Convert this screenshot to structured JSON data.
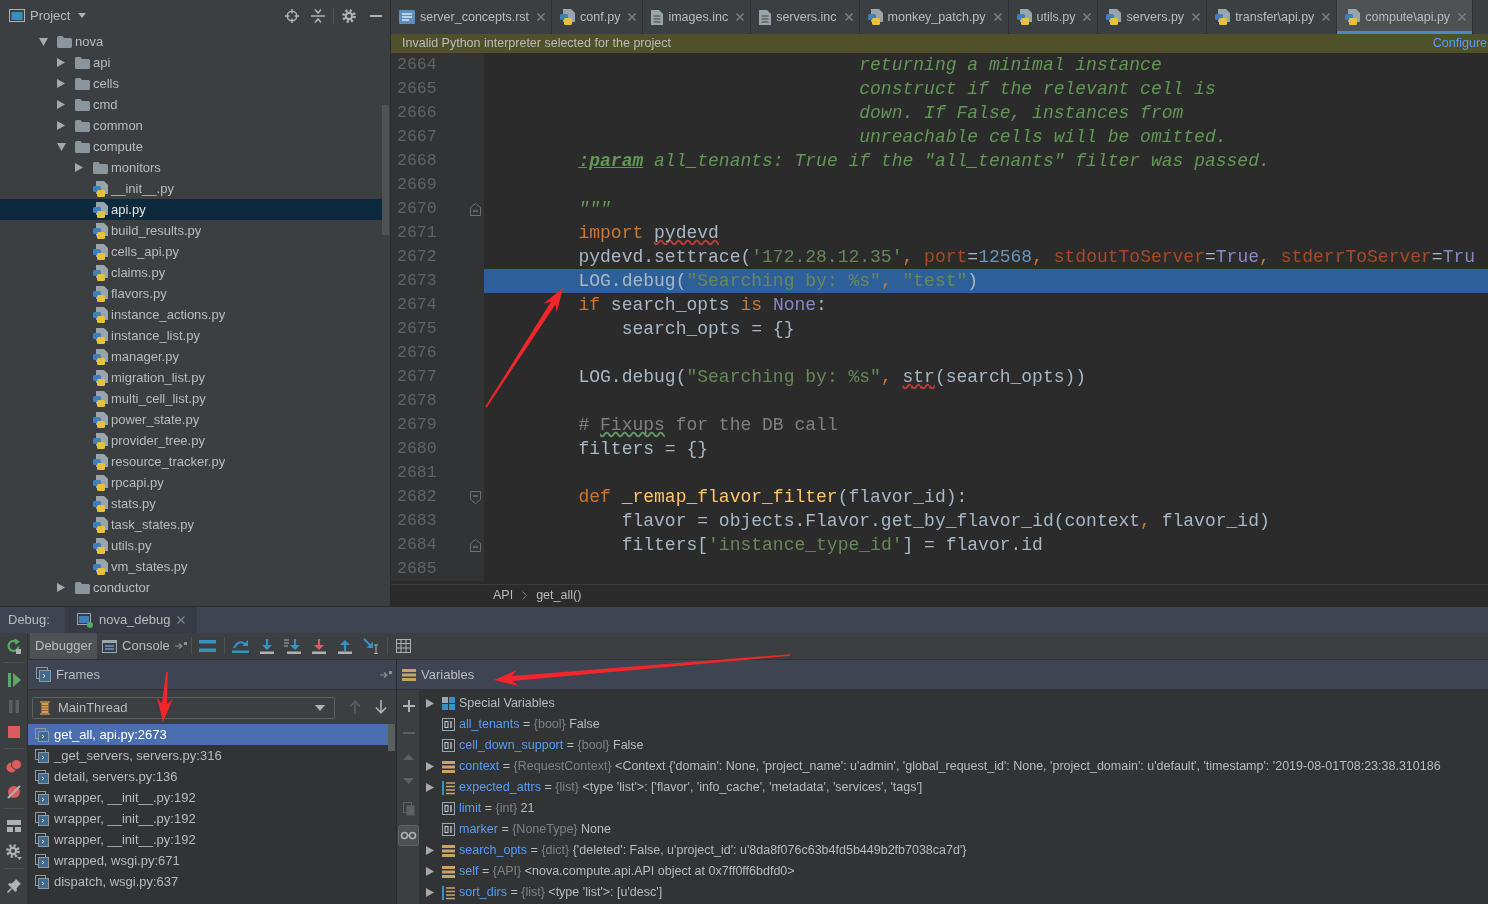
{
  "project_panel": {
    "title": "Project",
    "tree": [
      {
        "label": "nova",
        "kind": "folder",
        "expanded": true,
        "selected": false,
        "children": [
          {
            "label": "api",
            "kind": "folder",
            "expanded": false,
            "selected": false
          },
          {
            "label": "cells",
            "kind": "folder",
            "expanded": false,
            "selected": false
          },
          {
            "label": "cmd",
            "kind": "folder",
            "expanded": false,
            "selected": false
          },
          {
            "label": "common",
            "kind": "folder",
            "expanded": false,
            "selected": false
          },
          {
            "label": "compute",
            "kind": "folder",
            "expanded": true,
            "selected": false,
            "children": [
              {
                "label": "monitors",
                "kind": "folder",
                "expanded": false,
                "selected": false
              },
              {
                "label": "__init__.py",
                "kind": "python",
                "selected": false
              },
              {
                "label": "api.py",
                "kind": "python",
                "selected": true
              },
              {
                "label": "build_results.py",
                "kind": "python",
                "selected": false
              },
              {
                "label": "cells_api.py",
                "kind": "python",
                "selected": false
              },
              {
                "label": "claims.py",
                "kind": "python",
                "selected": false
              },
              {
                "label": "flavors.py",
                "kind": "python",
                "selected": false
              },
              {
                "label": "instance_actions.py",
                "kind": "python",
                "selected": false
              },
              {
                "label": "instance_list.py",
                "kind": "python",
                "selected": false
              },
              {
                "label": "manager.py",
                "kind": "python",
                "selected": false
              },
              {
                "label": "migration_list.py",
                "kind": "python",
                "selected": false
              },
              {
                "label": "multi_cell_list.py",
                "kind": "python",
                "selected": false
              },
              {
                "label": "power_state.py",
                "kind": "python",
                "selected": false
              },
              {
                "label": "provider_tree.py",
                "kind": "python",
                "selected": false
              },
              {
                "label": "resource_tracker.py",
                "kind": "python",
                "selected": false
              },
              {
                "label": "rpcapi.py",
                "kind": "python",
                "selected": false
              },
              {
                "label": "stats.py",
                "kind": "python",
                "selected": false
              },
              {
                "label": "task_states.py",
                "kind": "python",
                "selected": false
              },
              {
                "label": "utils.py",
                "kind": "python",
                "selected": false
              },
              {
                "label": "vm_states.py",
                "kind": "python",
                "selected": false
              }
            ]
          },
          {
            "label": "conductor",
            "kind": "folder",
            "expanded": false,
            "selected": false
          }
        ]
      }
    ]
  },
  "editor": {
    "tabs": [
      {
        "label": "server_concepts.rst",
        "kind": "rst",
        "selected": false
      },
      {
        "label": "conf.py",
        "kind": "python",
        "selected": false
      },
      {
        "label": "images.inc",
        "kind": "text",
        "selected": false
      },
      {
        "label": "servers.inc",
        "kind": "text",
        "selected": false
      },
      {
        "label": "monkey_patch.py",
        "kind": "python",
        "selected": false
      },
      {
        "label": "utils.py",
        "kind": "python",
        "selected": false
      },
      {
        "label": "servers.py",
        "kind": "python",
        "selected": false
      },
      {
        "label": "transfer\\api.py",
        "kind": "python",
        "selected": false
      },
      {
        "label": "compute\\api.py",
        "kind": "python",
        "selected": true
      }
    ],
    "banner": {
      "message": "Invalid Python interpreter selected for the project",
      "action": "Configure"
    },
    "code_lines": [
      {
        "number": "2664",
        "current": false,
        "tokens": [
          {
            "kind": "doc",
            "text": "                                  returning a minimal instance"
          }
        ]
      },
      {
        "number": "2665",
        "current": false,
        "tokens": [
          {
            "kind": "doc",
            "text": "                                  construct if the relevant cell is"
          }
        ]
      },
      {
        "number": "2666",
        "current": false,
        "tokens": [
          {
            "kind": "doc",
            "text": "                                  down. If False, instances from"
          }
        ]
      },
      {
        "number": "2667",
        "current": false,
        "tokens": [
          {
            "kind": "doc",
            "text": "                                  unreachable cells will be omitted."
          }
        ]
      },
      {
        "number": "2668",
        "current": false,
        "tokens": [
          {
            "kind": "doc_tag",
            "text": "        :param"
          },
          {
            "kind": "doc",
            "text": " all_tenants: True if the \"all_tenants\" filter was passed."
          }
        ]
      },
      {
        "number": "2669",
        "current": false
      },
      {
        "number": "2670",
        "current": false,
        "fold": {
          "kind": "end"
        },
        "tokens": [
          {
            "kind": "doc",
            "text": "        \"\"\""
          }
        ]
      },
      {
        "number": "2671",
        "current": false,
        "tokens": [
          {
            "kind": "keyword",
            "text": "        import"
          },
          {
            "kind": "unresolved",
            "text": " pydevd"
          }
        ]
      },
      {
        "number": "2672",
        "current": false,
        "tokens": [
          {
            "kind": "plain",
            "text": "        pydevd.settrace("
          },
          {
            "kind": "string",
            "text": "'172.28.12.35'"
          },
          {
            "kind": "delimiter",
            "text": ", "
          },
          {
            "kind": "param",
            "text": "port"
          },
          {
            "kind": "plain",
            "text": "="
          },
          {
            "kind": "number",
            "text": "12568"
          },
          {
            "kind": "delimiter",
            "text": ", "
          },
          {
            "kind": "param",
            "text": "stdoutToServer"
          },
          {
            "kind": "plain",
            "text": "="
          },
          {
            "kind": "constant",
            "text": "True"
          },
          {
            "kind": "delimiter",
            "text": ", "
          },
          {
            "kind": "param",
            "text": "stderrToServer"
          },
          {
            "kind": "plain",
            "text": "="
          },
          {
            "kind": "constant",
            "text": "Tru"
          }
        ]
      },
      {
        "number": "2673",
        "current": true,
        "tokens": [
          {
            "kind": "plain",
            "text": "        LOG.debug("
          },
          {
            "kind": "string",
            "text": "\"Searching by: %s\""
          },
          {
            "kind": "delimiter",
            "text": ", "
          },
          {
            "kind": "string",
            "text": "\"test\""
          },
          {
            "kind": "plain",
            "text": ")"
          }
        ]
      },
      {
        "number": "2674",
        "current": false,
        "tokens": [
          {
            "kind": "keyword",
            "text": "        if"
          },
          {
            "kind": "plain",
            "text": " search_opts "
          },
          {
            "kind": "keyword",
            "text": "is"
          },
          {
            "kind": "constant",
            "text": " None"
          },
          {
            "kind": "plain",
            "text": ":"
          }
        ]
      },
      {
        "number": "2675",
        "current": false,
        "tokens": [
          {
            "kind": "plain",
            "text": "            search_opts = {}"
          }
        ]
      },
      {
        "number": "2676",
        "current": false
      },
      {
        "number": "2677",
        "current": false,
        "tokens": [
          {
            "kind": "plain",
            "text": "        LOG.debug("
          },
          {
            "kind": "string",
            "text": "\"Searching by: %s\""
          },
          {
            "kind": "delimiter",
            "text": ", "
          },
          {
            "kind": "unresolved",
            "text": "str"
          },
          {
            "kind": "plain",
            "text": "(search_opts))"
          }
        ]
      },
      {
        "number": "2678",
        "current": false
      },
      {
        "number": "2679",
        "current": false,
        "tokens": [
          {
            "kind": "comment",
            "text": "        # "
          },
          {
            "kind": "typo",
            "text": "Fixups"
          },
          {
            "kind": "comment",
            "text": " for the DB call"
          }
        ]
      },
      {
        "number": "2680",
        "current": false,
        "tokens": [
          {
            "kind": "plain",
            "text": "        filters = {}"
          }
        ]
      },
      {
        "number": "2681",
        "current": false
      },
      {
        "number": "2682",
        "current": false,
        "fold": {
          "kind": "start"
        },
        "tokens": [
          {
            "kind": "keyword",
            "text": "        def"
          },
          {
            "kind": "function",
            "text": " _remap_flavor_filter"
          },
          {
            "kind": "plain",
            "text": "(flavor_id):"
          }
        ]
      },
      {
        "number": "2683",
        "current": false,
        "tokens": [
          {
            "kind": "plain",
            "text": "            flavor = objects.Flavor.get_by_flavor_id(context"
          },
          {
            "kind": "delimiter",
            "text": ", "
          },
          {
            "kind": "plain",
            "text": "flavor_id)"
          }
        ]
      },
      {
        "number": "2684",
        "current": false,
        "fold": {
          "kind": "end"
        },
        "tokens": [
          {
            "kind": "plain",
            "text": "            filters["
          },
          {
            "kind": "string",
            "text": "'instance_type_id'"
          },
          {
            "kind": "plain",
            "text": "] = flavor.id"
          }
        ]
      },
      {
        "number": "2685",
        "current": false
      }
    ],
    "breadcrumbs": [
      "API",
      "get_all()"
    ]
  },
  "debug": {
    "title": "Debug:",
    "session": "nova_debug",
    "side_toolbar": [
      {
        "kind": "rerun",
        "disabled": false
      },
      {
        "kind": "resume",
        "disabled": false
      },
      {
        "kind": "pause",
        "disabled": true
      },
      {
        "kind": "stop",
        "disabled": false
      },
      {
        "kind": "breakpoints",
        "disabled": false
      },
      {
        "kind": "mute_breakpoints",
        "disabled": false
      },
      {
        "kind": "layout",
        "disabled": false
      },
      {
        "kind": "settings",
        "disabled": false
      },
      {
        "kind": "pin",
        "disabled": false
      }
    ],
    "tabs": [
      {
        "label": "Debugger",
        "kind": "debugger",
        "selected": true
      },
      {
        "label": "Console",
        "kind": "console",
        "selected": false
      }
    ],
    "frames": {
      "title": "Frames",
      "thread": "MainThread",
      "navigation": [
        {
          "kind": "up",
          "disabled": true
        },
        {
          "kind": "down",
          "disabled": false
        }
      ],
      "items": [
        {
          "label": "get_all, api.py:2673",
          "selected": true
        },
        {
          "label": "_get_servers, servers.py:316",
          "selected": false
        },
        {
          "label": "detail, servers.py:136",
          "selected": false
        },
        {
          "label": "wrapper, __init__.py:192",
          "selected": false
        },
        {
          "label": "wrapper, __init__.py:192",
          "selected": false
        },
        {
          "label": "wrapper, __init__.py:192",
          "selected": false
        },
        {
          "label": "wrapped, wsgi.py:671",
          "selected": false
        },
        {
          "label": "dispatch, wsgi.py:637",
          "selected": false
        }
      ]
    },
    "variables": {
      "title": "Variables",
      "toolbar": [
        {
          "kind": "add",
          "disabled": false,
          "toggled": false
        },
        {
          "kind": "remove",
          "disabled": true,
          "toggled": false
        },
        {
          "kind": "move_up",
          "disabled": true,
          "toggled": false
        },
        {
          "kind": "move_down",
          "disabled": true,
          "toggled": false
        },
        {
          "kind": "copy",
          "disabled": true,
          "toggled": false
        },
        {
          "kind": "watches",
          "disabled": false,
          "toggled": true
        }
      ],
      "items": [
        {
          "name": "Special Variables",
          "kind": "group",
          "expanded": false
        },
        {
          "name": "all_tenants",
          "separator": "=",
          "type": "{bool}",
          "value": "False",
          "kind": "primitive"
        },
        {
          "name": "cell_down_support",
          "separator": "=",
          "type": "{bool}",
          "value": "False",
          "kind": "primitive"
        },
        {
          "name": "context",
          "separator": "=",
          "type": "{RequestContext}",
          "value": "<Context {'domain': None, 'project_name': u'admin', 'global_request_id': None, 'project_domain': u'default', 'timestamp': '2019-08-01T08:23:38.310186",
          "kind": "object",
          "expanded": false
        },
        {
          "name": "expected_attrs",
          "separator": "=",
          "type": "{list}",
          "value": "<type 'list'>: ['flavor', 'info_cache', 'metadata', 'services', 'tags']",
          "kind": "list",
          "expanded": false
        },
        {
          "name": "limit",
          "separator": "=",
          "type": "{int}",
          "value": "21",
          "kind": "primitive"
        },
        {
          "name": "marker",
          "separator": "=",
          "type": "{NoneType}",
          "value": "None",
          "kind": "primitive"
        },
        {
          "name": "search_opts",
          "separator": "=",
          "type": "{dict}",
          "value": "{'deleted': False, u'project_id': u'8da8f076c63b4fd5b449b2fb7038ca7d'}",
          "kind": "object",
          "expanded": false
        },
        {
          "name": "self",
          "separator": "=",
          "type": "{API}",
          "value": "<nova.compute.api.API object at 0x7ff0ff6bdfd0>",
          "kind": "object",
          "expanded": false
        },
        {
          "name": "sort_dirs",
          "separator": "=",
          "type": "{list}",
          "value": "<type 'list'>: [u'desc']",
          "kind": "list",
          "expanded": false
        }
      ]
    }
  }
}
